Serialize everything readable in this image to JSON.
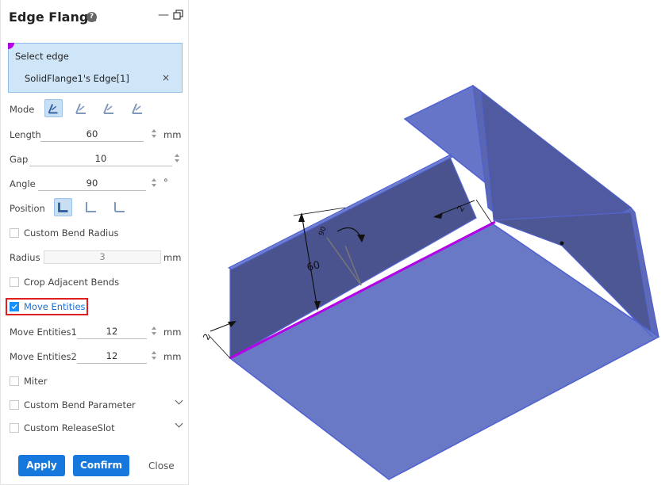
{
  "panel": {
    "title": "Edge Flange",
    "help_glyph": "?",
    "minimize_glyph": "—",
    "select": {
      "label": "Select edge",
      "item": "SolidFlange1's Edge[1]",
      "remove": "×"
    },
    "mode_label": "Mode",
    "length": {
      "label": "Length",
      "value": "60",
      "unit": "mm"
    },
    "gap": {
      "label": "Gap",
      "value": "10"
    },
    "angle": {
      "label": "Angle",
      "value": "90",
      "unit": "°"
    },
    "position_label": "Position",
    "custom_bend_radius": "Custom Bend Radius",
    "radius": {
      "label": "Radius",
      "value": "3",
      "unit": "mm"
    },
    "crop_adjacent_bends": "Crop Adjacent Bends",
    "move_entities": "Move Entities",
    "move_entities1": {
      "label": "Move Entities1",
      "value": "12",
      "unit": "mm"
    },
    "move_entities2": {
      "label": "Move Entities2",
      "value": "12",
      "unit": "mm"
    },
    "miter": "Miter",
    "custom_bend_parameter": "Custom Bend Parameter",
    "custom_release_slot": "Custom ReleaseSlot",
    "apply": "Apply",
    "confirm": "Confirm",
    "close": "Close"
  },
  "viewport": {
    "dim_height": "60",
    "dim_left": "2",
    "dim_right": "2",
    "dim_angle": "90"
  },
  "colors": {
    "accent": "#1677dc",
    "selection_highlight": "#b400e6",
    "model_face": "#6b7ac4",
    "model_edge": "#4a5bd0"
  }
}
